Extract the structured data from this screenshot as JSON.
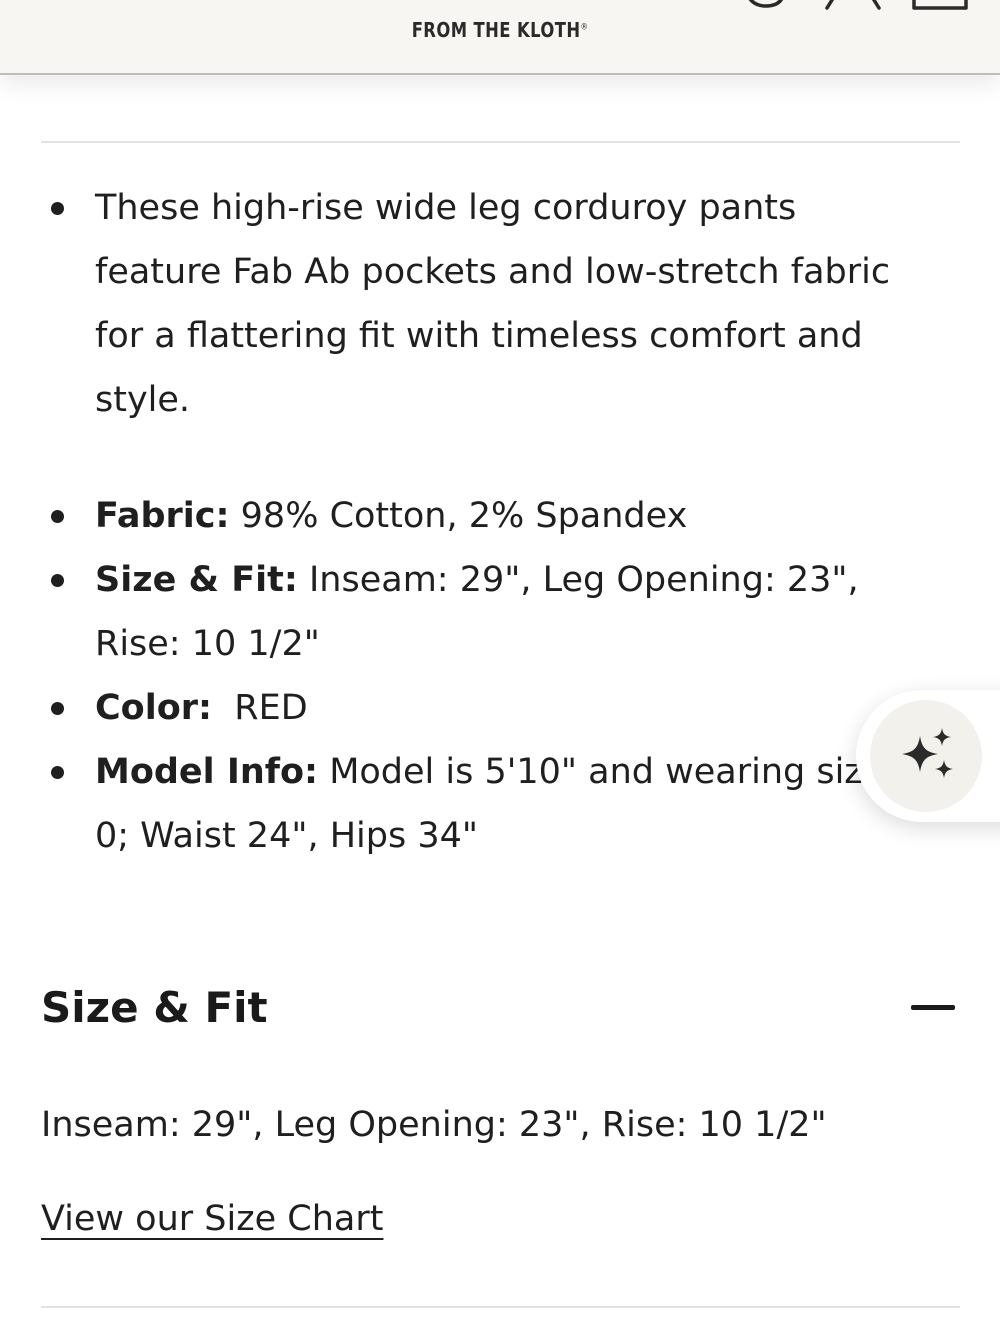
{
  "header": {
    "logo_tagline": "FROM THE KLOTH",
    "logo_registered": "®",
    "icons": [
      "menu-icon",
      "search-icon",
      "account-icon",
      "cart-icon"
    ]
  },
  "product_details": {
    "description": "These high-rise wide leg corduroy pants feature Fab Ab pockets and low-stretch fabric for a flattering fit with timeless comfort and style.",
    "specs": [
      {
        "label": "Fabric:",
        "value": " 98% Cotton, 2% Spandex"
      },
      {
        "label": "Size & Fit:",
        "value": " Inseam: 29\", Leg Opening: 23\", Rise: 10 1/2\""
      },
      {
        "label": "Color:",
        "value": "  RED"
      },
      {
        "label": "Model Info:",
        "value": " Model is 5'10\" and wearing size 0; Waist 24\", Hips 34\""
      }
    ]
  },
  "size_fit": {
    "title": "Size & Fit",
    "text": "Inseam: 29\", Leg Opening: 23\", Rise: 10 1/2\"",
    "link_label": "View our Size Chart"
  },
  "assistant": {
    "icon": "sparkle-icon"
  },
  "colors": {
    "header_bg": "#f7f6f3",
    "text": "#1f1f1f",
    "divider": "#e2e2e2",
    "assistant_bg": "#f2f1ec"
  }
}
